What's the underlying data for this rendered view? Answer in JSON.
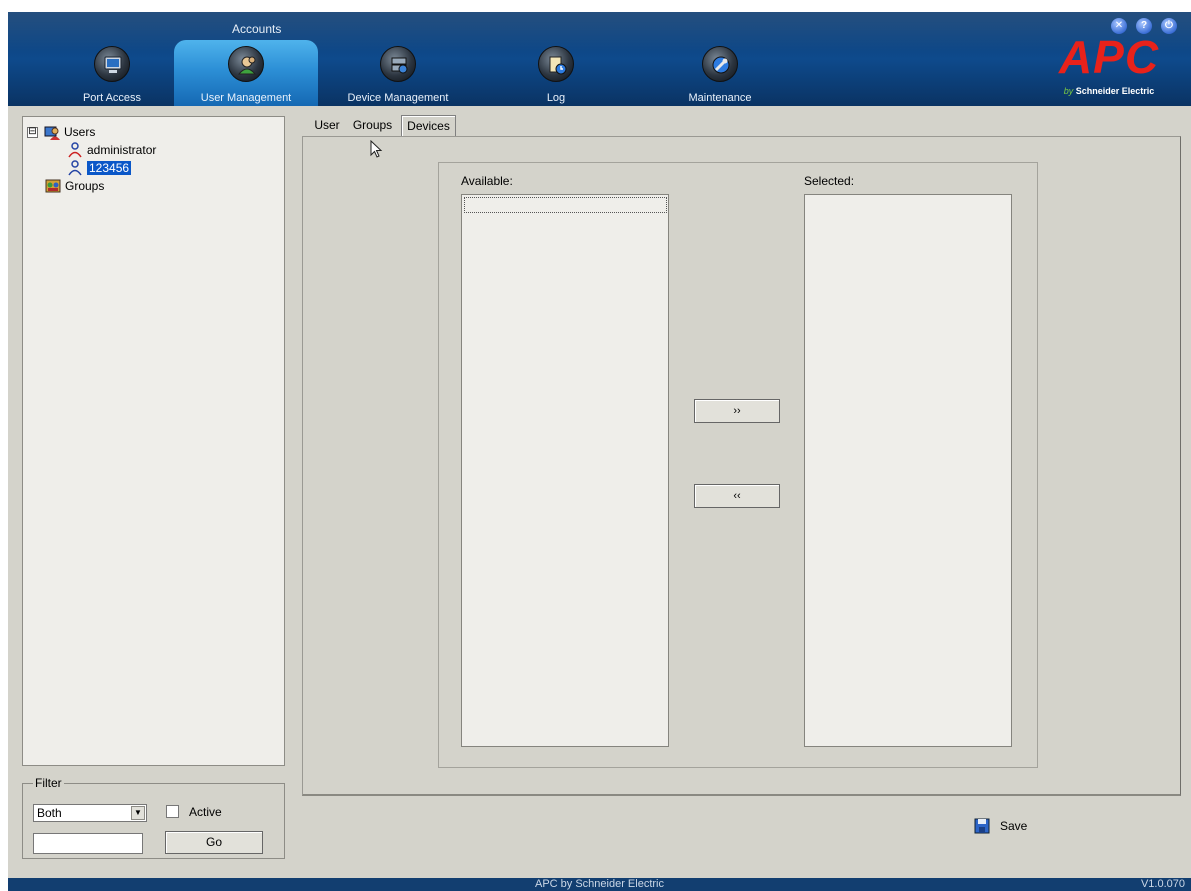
{
  "header": {
    "section_label": "Accounts",
    "nav": [
      {
        "label": "Port Access",
        "icon": "port-access-icon"
      },
      {
        "label": "User Management",
        "icon": "user-management-icon",
        "active": true
      },
      {
        "label": "Device Management",
        "icon": "device-management-icon"
      },
      {
        "label": "Log",
        "icon": "log-icon"
      },
      {
        "label": "Maintenance",
        "icon": "maintenance-icon"
      }
    ],
    "window_controls": [
      {
        "name": "close-icon",
        "glyph": "✕"
      },
      {
        "name": "help-icon",
        "glyph": "?"
      },
      {
        "name": "logout-icon",
        "glyph": "⏻"
      }
    ],
    "logo": {
      "brand": "APC",
      "by": "by",
      "maker": "Schneider Electric"
    }
  },
  "tree": {
    "users_label": "Users",
    "users": [
      "administrator",
      "123456"
    ],
    "selected_user": "123456",
    "groups_label": "Groups",
    "expander": "⊟"
  },
  "filter": {
    "legend": "Filter",
    "select_value": "Both",
    "active_label": "Active",
    "active_checked": false,
    "input_value": "",
    "go_label": "Go"
  },
  "tabs": [
    {
      "label": "User"
    },
    {
      "label": "Groups",
      "active": true
    },
    {
      "label": "Devices"
    }
  ],
  "lists": {
    "available_label": "Available:",
    "selected_label": "Selected:",
    "available_items": [],
    "selected_items": []
  },
  "buttons": {
    "add": "››",
    "remove": "‹‹",
    "save": "Save"
  },
  "footer": {
    "center": "APC by Schneider Electric",
    "version": "V1.0.070"
  },
  "colors": {
    "header_bg": "#0e4a8c",
    "active_tab": "#2c8fd6",
    "brand_red": "#e8221b",
    "selection": "#0a57c8",
    "panel_bg": "#d4d3cb"
  }
}
